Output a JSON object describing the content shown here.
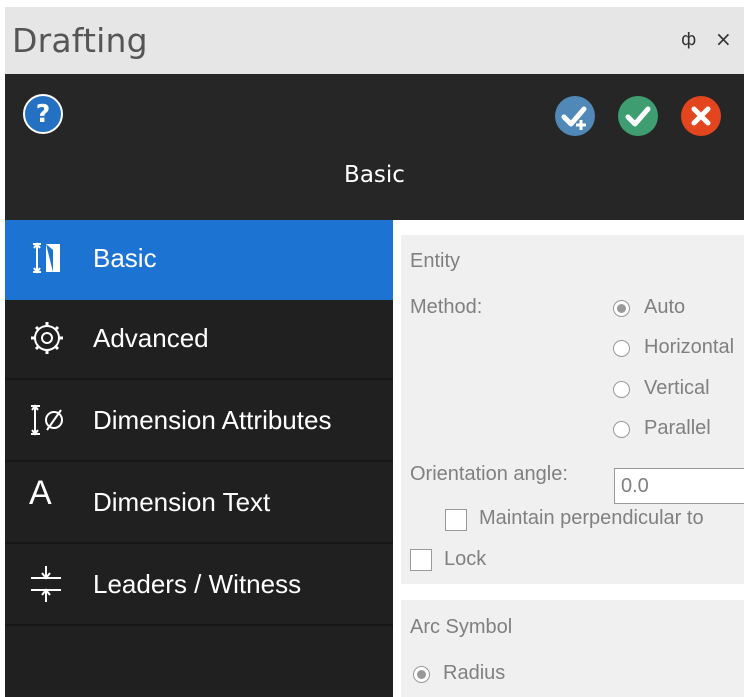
{
  "window": {
    "title": "Drafting",
    "pin_glyph": "ф",
    "close_glyph": "×"
  },
  "header": {
    "page_name": "Basic",
    "help_icon": "?",
    "buttons": [
      "apply-add-icon",
      "ok-check-icon",
      "cancel-x-icon"
    ]
  },
  "sidebar": {
    "items": [
      {
        "label": "Basic",
        "icon": "dimension-basic-icon",
        "active": true
      },
      {
        "label": "Advanced",
        "icon": "gear-icon"
      },
      {
        "label": "Dimension Attributes",
        "icon": "diameter-dimension-icon"
      },
      {
        "label": "Dimension Text",
        "icon": "A"
      },
      {
        "label": "Leaders / Witness",
        "icon": "leader-witness-icon"
      }
    ]
  },
  "entity": {
    "section_title": "Entity",
    "method_label": "Method:",
    "method_options": [
      "Auto",
      "Horizontal",
      "Vertical",
      "Parallel"
    ],
    "method_selected": "Auto",
    "orientation_label": "Orientation angle:",
    "orientation_value": "0.0",
    "maintain_label": "Maintain perpendicular to",
    "lock_label": "Lock"
  },
  "arc_symbol": {
    "section_title": "Arc Symbol",
    "options": [
      "Radius"
    ],
    "selected": "Radius"
  },
  "colors": {
    "accent": "#1d73d1",
    "header_bg": "#262626",
    "sidebar_bg": "#202020",
    "panel_bg": "#f0f0f0"
  }
}
